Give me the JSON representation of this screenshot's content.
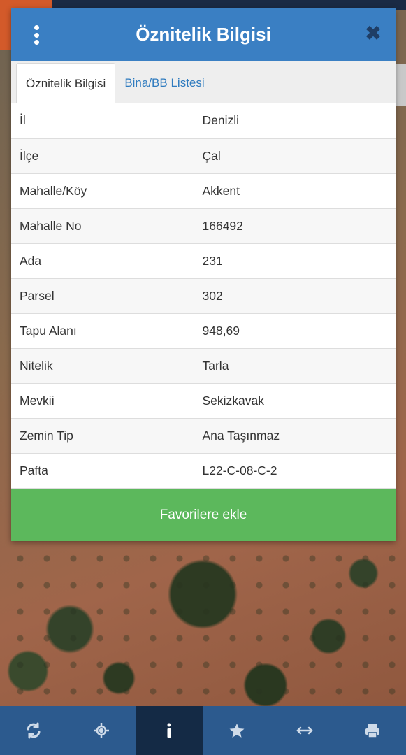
{
  "dialog": {
    "title": "Öznitelik Bilgisi",
    "menu_icon": "more-vertical-icon",
    "close_icon": "close-icon"
  },
  "tabs": [
    {
      "label": "Öznitelik Bilgisi",
      "active": true
    },
    {
      "label": "Bina/BB Listesi",
      "active": false
    }
  ],
  "attributes": [
    {
      "key": "İl",
      "value": "Denizli"
    },
    {
      "key": "İlçe",
      "value": "Çal"
    },
    {
      "key": "Mahalle/Köy",
      "value": "Akkent"
    },
    {
      "key": "Mahalle No",
      "value": "166492"
    },
    {
      "key": "Ada",
      "value": "231"
    },
    {
      "key": "Parsel",
      "value": "302"
    },
    {
      "key": "Tapu Alanı",
      "value": "948,69"
    },
    {
      "key": "Nitelik",
      "value": "Tarla"
    },
    {
      "key": "Mevkii",
      "value": "Sekizkavak"
    },
    {
      "key": "Zemin Tip",
      "value": "Ana Taşınmaz"
    },
    {
      "key": "Pafta",
      "value": "L22-C-08-C-2"
    }
  ],
  "favorite_button": "Favorilere ekle",
  "toolbar": {
    "items": [
      {
        "icon": "refresh-icon"
      },
      {
        "icon": "locate-icon"
      },
      {
        "icon": "info-icon",
        "active": true
      },
      {
        "icon": "star-icon"
      },
      {
        "icon": "measure-icon"
      },
      {
        "icon": "print-icon"
      }
    ]
  },
  "colors": {
    "header": "#3a7fc3",
    "favorite": "#5cb85c",
    "toolbar": "#2c5a8e",
    "toolbar_active": "#142a45"
  }
}
